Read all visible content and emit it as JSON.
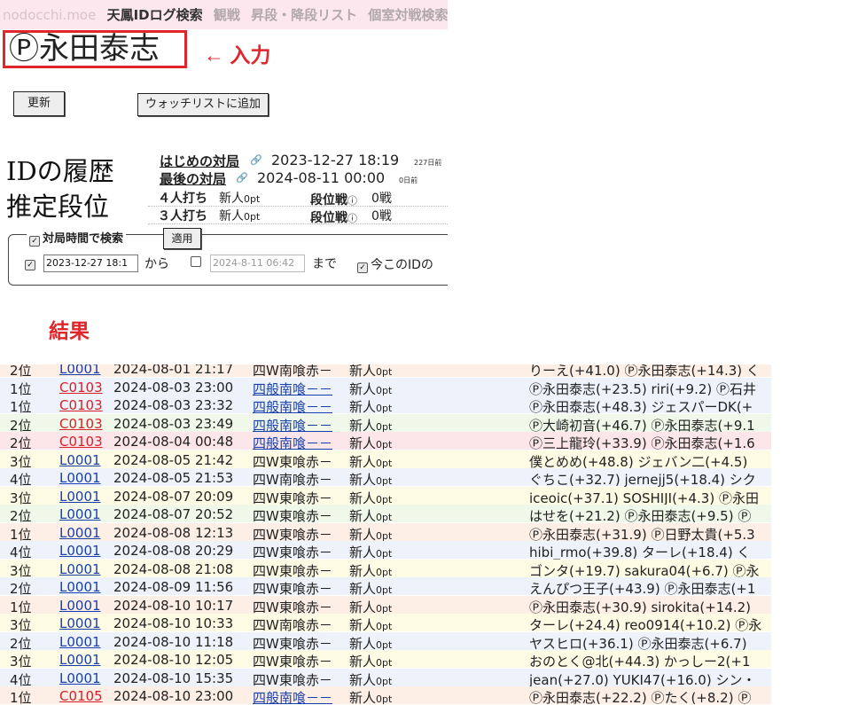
{
  "topnav": {
    "site": "nodocchi.moe",
    "items": [
      "天鳳IDログ検索",
      "観戦",
      "昇段・降段リスト",
      "個室対戦検索"
    ]
  },
  "player_name": "Ⓟ永田泰志",
  "annotations": {
    "input": "← 入力",
    "result": "結果"
  },
  "buttons": {
    "refresh": "更新",
    "watchlist": "ウォッチリストに追加"
  },
  "labels": {
    "id_history": "IDの履歴",
    "estimated_rank": "推定段位"
  },
  "games": {
    "first": {
      "label": "はじめの対局",
      "date": "2023-12-27 18:19",
      "ago": "227日前"
    },
    "last": {
      "label": "最後の対局",
      "date": "2024-08-11 00:00",
      "ago": "0日前"
    }
  },
  "ranks": [
    {
      "mode": "４人打ち",
      "dan": "新人",
      "pt": "0pt",
      "war_label": "段位戦",
      "info": "ⓘ",
      "count": "0戦"
    },
    {
      "mode": "３人打ち",
      "dan": "新人",
      "pt": "0pt",
      "war_label": "段位戦",
      "info": "ⓘ",
      "count": "0戦"
    }
  ],
  "filter": {
    "legend": "対局時間で検索",
    "apply": "適用",
    "from_value": "2023-12-27 18:1",
    "from_suffix": "から",
    "to_value": "2024-8-11 06:42",
    "to_suffix": "まで",
    "current_id_label": "今このIDの"
  },
  "colors": {
    "accent_red": "#e0262b",
    "link_blue": "#1a3fa8",
    "lobby_red": "#d6212a",
    "row_peach": "#fdeee6",
    "row_blue": "#eef3fb",
    "row_green": "#eff8e9",
    "row_pink": "#fce6ea",
    "row_yellow": "#fdfbe3"
  },
  "results": [
    {
      "rank": "2位",
      "lobby": "L0001",
      "lobby_color": "blue",
      "date": "2024-08-01 21:17",
      "rule": "四W南喰赤－",
      "rule_link": false,
      "dan": "新人",
      "pt": "0pt",
      "players": "りーえ(+41.0) Ⓟ永田泰志(+14.3) く",
      "bg": "peach"
    },
    {
      "rank": "1位",
      "lobby": "C0103",
      "lobby_color": "red",
      "date": "2024-08-03 23:00",
      "rule": "四般南喰－－",
      "rule_link": true,
      "dan": "新人",
      "pt": "0pt",
      "players": "Ⓟ永田泰志(+23.5) riri(+9.2) Ⓟ石井",
      "bg": "blue"
    },
    {
      "rank": "1位",
      "lobby": "C0103",
      "lobby_color": "red",
      "date": "2024-08-03 23:32",
      "rule": "四般南喰－－",
      "rule_link": true,
      "dan": "新人",
      "pt": "0pt",
      "players": "Ⓟ永田泰志(+48.3) ジェスパーDK(+",
      "bg": "blue"
    },
    {
      "rank": "2位",
      "lobby": "C0103",
      "lobby_color": "red",
      "date": "2024-08-03 23:49",
      "rule": "四般南喰－－",
      "rule_link": true,
      "dan": "新人",
      "pt": "0pt",
      "players": "Ⓟ大崎初音(+46.7) Ⓟ永田泰志(+9.1",
      "bg": "green"
    },
    {
      "rank": "2位",
      "lobby": "C0103",
      "lobby_color": "red",
      "date": "2024-08-04 00:48",
      "rule": "四般南喰－－",
      "rule_link": true,
      "dan": "新人",
      "pt": "0pt",
      "players": "Ⓟ三上龍玲(+33.9) Ⓟ永田泰志(+1.6",
      "bg": "pink"
    },
    {
      "rank": "3位",
      "lobby": "L0001",
      "lobby_color": "blue",
      "date": "2024-08-05 21:42",
      "rule": "四W東喰赤－",
      "rule_link": false,
      "dan": "新人",
      "pt": "0pt",
      "players": "僕とめめ(+48.8) ジェバン二(+4.5)",
      "bg": "yellow"
    },
    {
      "rank": "4位",
      "lobby": "L0001",
      "lobby_color": "blue",
      "date": "2024-08-05 21:53",
      "rule": "四W南喰赤－",
      "rule_link": false,
      "dan": "新人",
      "pt": "0pt",
      "players": "ぐちこ(+32.7) jernejj5(+18.4) シク",
      "bg": "blue"
    },
    {
      "rank": "3位",
      "lobby": "L0001",
      "lobby_color": "blue",
      "date": "2024-08-07 20:09",
      "rule": "四W東喰赤－",
      "rule_link": false,
      "dan": "新人",
      "pt": "0pt",
      "players": "iceoic(+37.1) SOSHIJI(+4.3) Ⓟ永田",
      "bg": "yellow"
    },
    {
      "rank": "2位",
      "lobby": "L0001",
      "lobby_color": "blue",
      "date": "2024-08-07 20:52",
      "rule": "四W東喰赤－",
      "rule_link": false,
      "dan": "新人",
      "pt": "0pt",
      "players": "はせを(+21.2) Ⓟ永田泰志(+9.5) Ⓟ",
      "bg": "green"
    },
    {
      "rank": "1位",
      "lobby": "L0001",
      "lobby_color": "blue",
      "date": "2024-08-08 12:13",
      "rule": "四W東喰赤－",
      "rule_link": false,
      "dan": "新人",
      "pt": "0pt",
      "players": "Ⓟ永田泰志(+31.9) Ⓟ日野太貴(+5.3",
      "bg": "peach"
    },
    {
      "rank": "4位",
      "lobby": "L0001",
      "lobby_color": "blue",
      "date": "2024-08-08 20:29",
      "rule": "四W東喰赤－",
      "rule_link": false,
      "dan": "新人",
      "pt": "0pt",
      "players": "hibi_rmo(+39.8) ターレ(+18.4) く",
      "bg": "blue"
    },
    {
      "rank": "3位",
      "lobby": "L0001",
      "lobby_color": "blue",
      "date": "2024-08-08 21:08",
      "rule": "四W東喰赤－",
      "rule_link": false,
      "dan": "新人",
      "pt": "0pt",
      "players": "ゴンタ(+19.7) sakura04(+6.7) Ⓟ永",
      "bg": "yellow"
    },
    {
      "rank": "2位",
      "lobby": "L0001",
      "lobby_color": "blue",
      "date": "2024-08-09 11:56",
      "rule": "四W東喰赤－",
      "rule_link": false,
      "dan": "新人",
      "pt": "0pt",
      "players": "えんぴつ王子(+43.9) Ⓟ永田泰志(+1",
      "bg": "blue"
    },
    {
      "rank": "1位",
      "lobby": "L0001",
      "lobby_color": "blue",
      "date": "2024-08-10 10:17",
      "rule": "四W東喰赤－",
      "rule_link": false,
      "dan": "新人",
      "pt": "0pt",
      "players": "Ⓟ永田泰志(+30.9) sirokita(+14.2)",
      "bg": "peach"
    },
    {
      "rank": "3位",
      "lobby": "L0001",
      "lobby_color": "blue",
      "date": "2024-08-10 10:33",
      "rule": "四W南喰赤－",
      "rule_link": false,
      "dan": "新人",
      "pt": "0pt",
      "players": "ターレ(+24.4) reo0914(+10.2) Ⓟ永",
      "bg": "yellow"
    },
    {
      "rank": "2位",
      "lobby": "L0001",
      "lobby_color": "blue",
      "date": "2024-08-10 11:18",
      "rule": "四W東喰赤－",
      "rule_link": false,
      "dan": "新人",
      "pt": "0pt",
      "players": "ヤスヒロ(+36.1) Ⓟ永田泰志(+6.7)",
      "bg": "blue"
    },
    {
      "rank": "3位",
      "lobby": "L0001",
      "lobby_color": "blue",
      "date": "2024-08-10 12:05",
      "rule": "四W東喰赤－",
      "rule_link": false,
      "dan": "新人",
      "pt": "0pt",
      "players": "おのとく@北(+44.3) かっしー2(+1",
      "bg": "yellow"
    },
    {
      "rank": "4位",
      "lobby": "L0001",
      "lobby_color": "blue",
      "date": "2024-08-10 15:35",
      "rule": "四W東喰赤－",
      "rule_link": false,
      "dan": "新人",
      "pt": "0pt",
      "players": "jean(+27.0) YUKI47(+16.0) シン・",
      "bg": "blue"
    },
    {
      "rank": "1位",
      "lobby": "C0105",
      "lobby_color": "red",
      "date": "2024-08-10 23:00",
      "rule": "四般南喰－－",
      "rule_link": true,
      "dan": "新人",
      "pt": "0pt",
      "players": "Ⓟ永田泰志(+22.2) Ⓟたく(+8.2) Ⓟ",
      "bg": "peach"
    }
  ]
}
